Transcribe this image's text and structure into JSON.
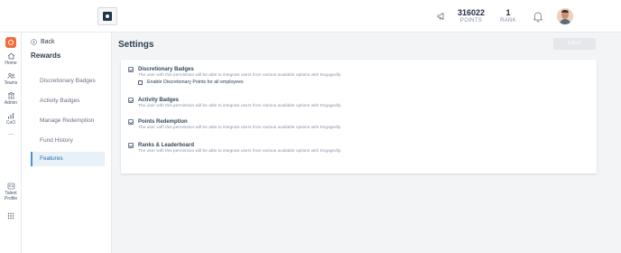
{
  "topbar": {
    "points_value": "316022",
    "points_label": "POINTS",
    "rank_value": "1",
    "rank_label": "RANK"
  },
  "rail": {
    "items": [
      {
        "label": "Home",
        "icon": "home-icon"
      },
      {
        "label": "Teams",
        "icon": "teams-icon"
      },
      {
        "label": "Admin",
        "icon": "admin-icon"
      },
      {
        "label": "CoO",
        "icon": "chart-icon"
      },
      {
        "label": "...",
        "icon": "more-icon"
      },
      {
        "label": "Talent Profile",
        "icon": "talent-profile-icon"
      },
      {
        "label": "",
        "icon": "grid-icon"
      }
    ]
  },
  "sidebar": {
    "back_label": "Back",
    "title": "Rewards",
    "items": [
      {
        "label": "Discretionary Badges"
      },
      {
        "label": "Activity Badges"
      },
      {
        "label": "Manage Redemption"
      },
      {
        "label": "Fund History"
      },
      {
        "label": "Features",
        "active": true
      }
    ]
  },
  "main": {
    "title": "Settings",
    "save_label": "SAVE",
    "permissions": [
      {
        "title": "Discretionary Badges",
        "checked": true,
        "description": "The user with this permission will be able to integrate users from various available options with Engagedly.",
        "sub_option": "Enable Discretionary Points for all employees"
      },
      {
        "title": "Activity Badges",
        "checked": true,
        "description": "The user with this permission will be able to integrate users from various available options with Engagedly."
      },
      {
        "title": "Points Redemption",
        "checked": true,
        "description": "The user with this permission will be able to integrate users from various available options with Engagedly."
      },
      {
        "title": "Ranks & Leaderboard",
        "checked": true,
        "description": "The user with this permission will be able to integrate users from various available options with Engagedly."
      }
    ]
  },
  "colors": {
    "brand": "#f26b3a",
    "active_bg": "#e8f0f8",
    "active_text": "#2b6cb0",
    "save_disabled": "#e5e7ea"
  }
}
